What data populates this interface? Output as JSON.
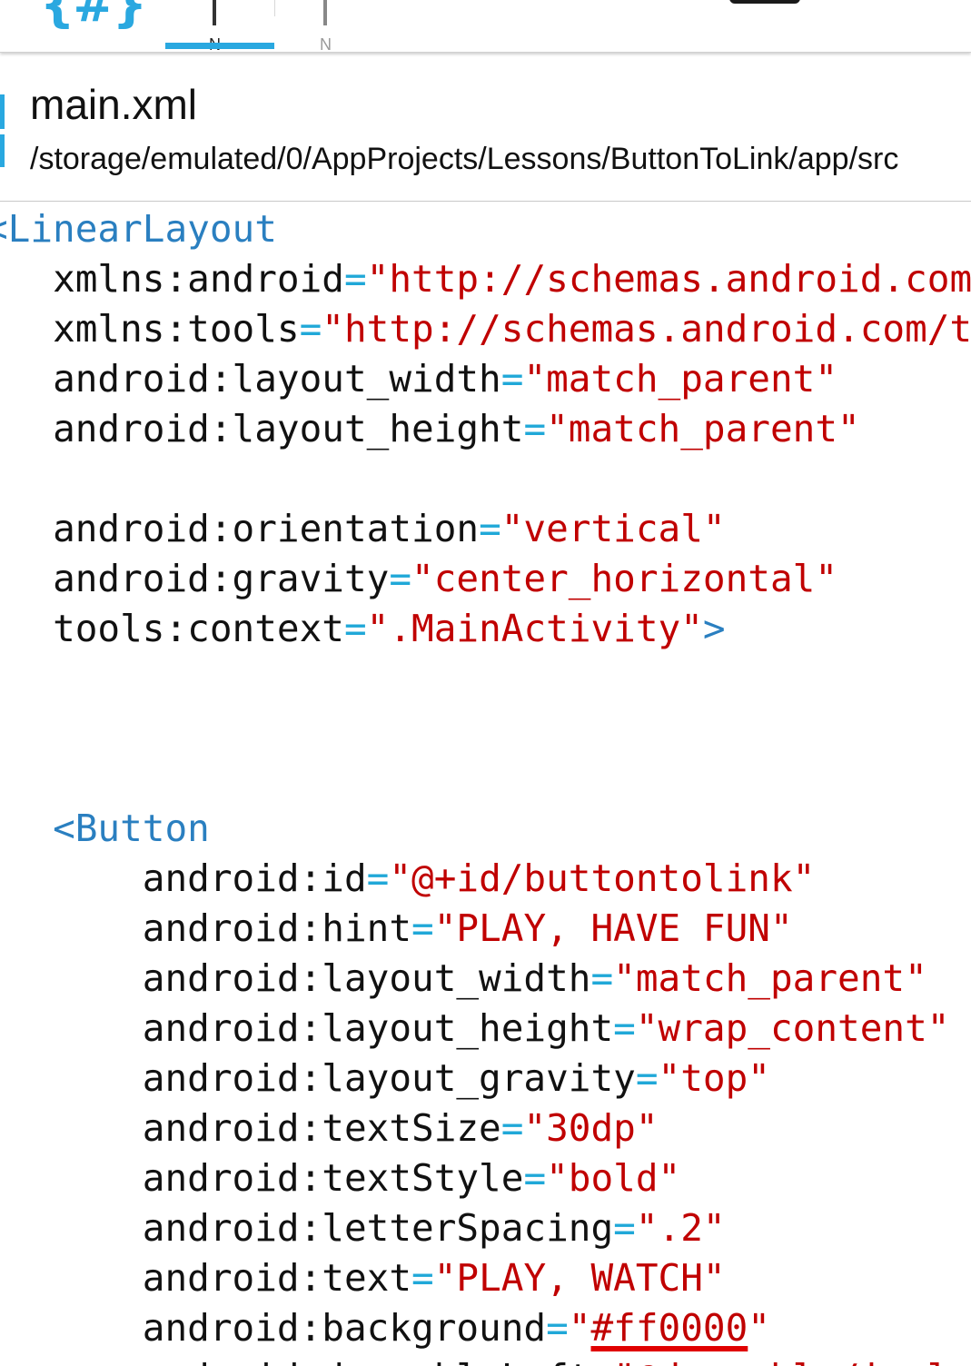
{
  "toolbar": {
    "logo_text": "{#}",
    "tabs": [
      {
        "label": "N",
        "active": true
      },
      {
        "label": "N",
        "active": false
      }
    ],
    "accent_color": "#29a8e0"
  },
  "file": {
    "name": "main.xml",
    "path": "/storage/emulated/0/AppProjects/Lessons/ButtonToLink/app/src"
  },
  "code": {
    "lines": [
      {
        "indent": "",
        "tag": "<LinearLayout"
      },
      {
        "indent": "   ",
        "attr": "xmlns:android",
        "value": "\"http://schemas.android.com/apk/res/android\""
      },
      {
        "indent": "   ",
        "attr": "xmlns:tools",
        "value": "\"http://schemas.android.com/tools\""
      },
      {
        "indent": "   ",
        "attr": "android:layout_width",
        "value": "\"match_parent\""
      },
      {
        "indent": "   ",
        "attr": "android:layout_height",
        "value": "\"match_parent\""
      },
      {
        "indent": ""
      },
      {
        "indent": "   ",
        "attr": "android:orientation",
        "value": "\"vertical\""
      },
      {
        "indent": "   ",
        "attr": "android:gravity",
        "value": "\"center_horizontal\""
      },
      {
        "indent": "   ",
        "attr": "tools:context",
        "value": "\".MainActivity\"",
        "close": ">"
      },
      {
        "indent": ""
      },
      {
        "indent": ""
      },
      {
        "indent": ""
      },
      {
        "indent": "   ",
        "tag": "<Button"
      },
      {
        "indent": "       ",
        "attr": "android:id",
        "value": "\"@+id/buttontolink\""
      },
      {
        "indent": "       ",
        "attr": "android:hint",
        "value": "\"PLAY, HAVE FUN\""
      },
      {
        "indent": "       ",
        "attr": "android:layout_width",
        "value": "\"match_parent\""
      },
      {
        "indent": "       ",
        "attr": "android:layout_height",
        "value": "\"wrap_content\""
      },
      {
        "indent": "       ",
        "attr": "android:layout_gravity",
        "value": "\"top\""
      },
      {
        "indent": "       ",
        "attr": "android:textSize",
        "value": "\"30dp\""
      },
      {
        "indent": "       ",
        "attr": "android:textStyle",
        "value": "\"bold\""
      },
      {
        "indent": "       ",
        "attr": "android:letterSpacing",
        "value": "\".2\""
      },
      {
        "indent": "       ",
        "attr": "android:text",
        "value": "\"PLAY, WATCH\""
      },
      {
        "indent": "       ",
        "attr": "android:background",
        "value_open": "\"",
        "value_err": "#ff0000",
        "value_close": "\""
      },
      {
        "indent": "       ",
        "attr": "android:drawableLeft",
        "value": "\"@drawable/ic_launcher\""
      }
    ]
  }
}
